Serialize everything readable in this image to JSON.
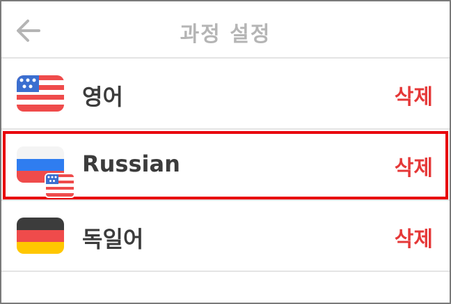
{
  "header": {
    "title": "과정 설정",
    "back_icon": "arrow-left-icon"
  },
  "courses": [
    {
      "label": "영어",
      "flag_icon": "us-flag-icon",
      "delete_label": "삭제"
    },
    {
      "label": "Russian",
      "flag_icon": "russia-flag-icon",
      "from_flag_icon": "us-flag-icon",
      "delete_label": "삭제",
      "selected": true
    },
    {
      "label": "독일어",
      "flag_icon": "germany-flag-icon",
      "delete_label": "삭제"
    }
  ],
  "colors": {
    "title": "#b5b5b5",
    "label": "#3c3c3c",
    "delete": "#e53838",
    "highlight": "#e8000b",
    "divider": "#e4e4e4"
  }
}
